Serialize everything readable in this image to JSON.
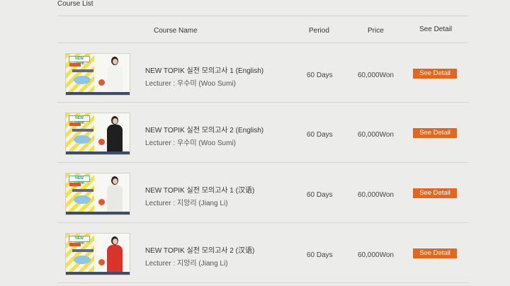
{
  "section_title": "Course List",
  "headers": {
    "name": "Course Name",
    "period": "Period",
    "price": "Price",
    "detail": "See Detail"
  },
  "thumbnail": {
    "logo_text": "NEW TOPIK"
  },
  "courses": [
    {
      "name": "NEW TOPIK 실전 모의고사 1 (English)",
      "lecturer": "Lecturer : 우수미 (Woo Sumi)",
      "period": "60 Days",
      "price": "60,000Won",
      "button": "See Detail",
      "outfit_color": "#f2f2ee"
    },
    {
      "name": "NEW TOPIK 실전 모의고사 2 (English)",
      "lecturer": "Lecturer : 우수미 (Woo Sumi)",
      "period": "60 Days",
      "price": "60,000Won",
      "button": "See Detail",
      "outfit_color": "#1f1f22"
    },
    {
      "name": "NEW TOPIK 실전 모의고사 1 (汉语)",
      "lecturer": "Lecturer : 지앙리 (Jiang Li)",
      "period": "60 Days",
      "price": "60,000Won",
      "button": "See Detail",
      "outfit_color": "#e9e9e4"
    },
    {
      "name": "NEW TOPIK 실전 모의고사 2 (汉语)",
      "lecturer": "Lecturer : 지앙리 (Jiang Li)",
      "period": "60 Days",
      "price": "60,000Won",
      "button": "See Detail",
      "outfit_color": "#d9332a"
    }
  ]
}
